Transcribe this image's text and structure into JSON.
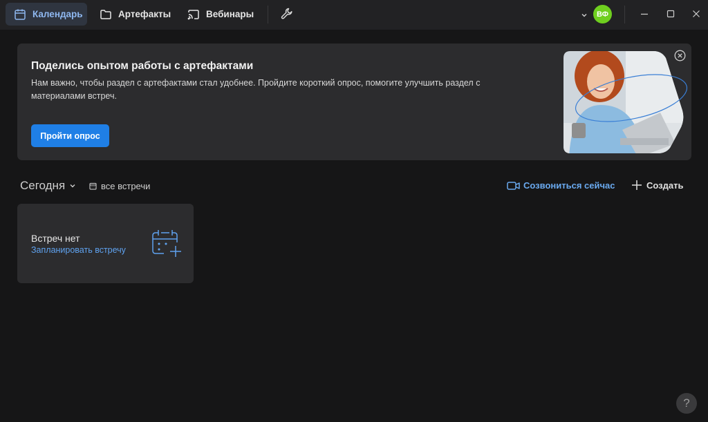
{
  "nav": {
    "tabs": [
      {
        "label": "Календарь",
        "icon": "calendar-icon",
        "active": true
      },
      {
        "label": "Артефакты",
        "icon": "folder-icon"
      },
      {
        "label": "Вебинары",
        "icon": "cast-icon"
      }
    ],
    "tools_icon": "wrench-icon",
    "avatar_initials": "ВФ",
    "avatar_color": "#6fcf1f"
  },
  "banner": {
    "title": "Поделись опытом работы с артефактами",
    "text": "Нам важно, чтобы раздел с артефактами стал удобнее. Пройдите короткий опрос, помогите улучшить раздел с материалами встреч.",
    "button_label": "Пройти опрос"
  },
  "toolbar": {
    "period_label": "Сегодня",
    "all_meetings_label": "все встречи",
    "call_now_label": "Созвониться сейчас",
    "create_label": "Создать"
  },
  "empty_state": {
    "title": "Встреч нет",
    "link": "Запланировать встречу"
  },
  "help_label": "?",
  "colors": {
    "accent": "#1f7fe6",
    "link": "#5fa2ef",
    "background": "#161617",
    "surface": "#2c2c2e"
  }
}
